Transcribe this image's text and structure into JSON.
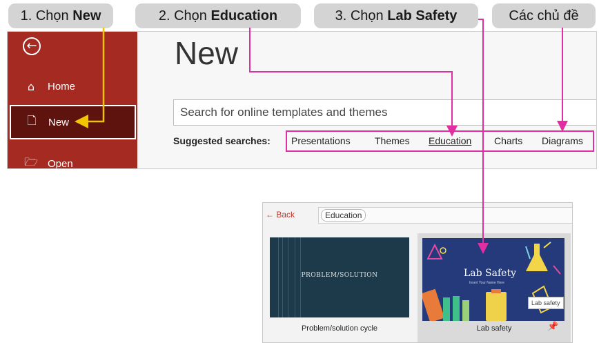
{
  "callouts": {
    "step1": {
      "prefix": "1. Chọn ",
      "bold": "New"
    },
    "step2": {
      "prefix": "2. Chọn ",
      "bold": "Education"
    },
    "step3": {
      "prefix": "3. Chọn ",
      "bold": "Lab Safety"
    },
    "step4": {
      "label": "Các chủ đề"
    }
  },
  "backstage": {
    "sidebar": [
      {
        "icon": "home-icon",
        "label": "Home"
      },
      {
        "icon": "new-document-icon",
        "label": "New"
      },
      {
        "icon": "open-folder-icon",
        "label": "Open"
      }
    ],
    "title": "New",
    "search_placeholder": "Search for online templates and themes",
    "suggested_label": "Suggested searches:",
    "suggested": [
      "Presentations",
      "Themes",
      "Education",
      "Charts",
      "Diagrams"
    ]
  },
  "education": {
    "back_label": "Back",
    "category": "Education",
    "templates": [
      {
        "caption": "Problem/solution cycle",
        "slide_title": "PROBLEM/SOLUTION"
      },
      {
        "caption": "Lab safety",
        "slide_title": "Lab Safety",
        "slide_subtitle": "Insert Your Name Here"
      }
    ],
    "tooltip": "Lab safety"
  },
  "colors": {
    "sidebar": "#a52a22",
    "selected": "#5e130f",
    "callout_arrow": "#e12fa3",
    "step1_arrow": "#f2c500"
  }
}
